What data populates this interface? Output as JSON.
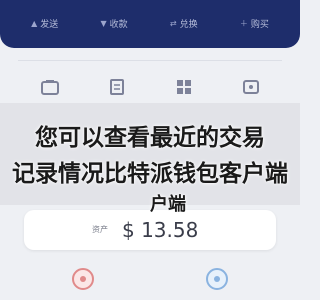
{
  "top_bar": {
    "items": [
      {
        "icon": "send-icon",
        "label": "发送"
      },
      {
        "icon": "receive-icon",
        "label": "收款"
      },
      {
        "icon": "swap-icon",
        "label": "兑换"
      },
      {
        "icon": "buy-icon",
        "label": "购买"
      }
    ]
  },
  "feature_icons": [
    "wallet-icon",
    "document-icon",
    "grid-icon",
    "more-icon"
  ],
  "overlay": {
    "line1": "您可以查看最近的交易",
    "line2": "记录情况比特派钱包客户端",
    "line3": "户端"
  },
  "balance": {
    "label": "资产",
    "amount": "$ 13.58"
  },
  "bottom_avatars": [
    "avatar-red",
    "avatar-blue"
  ]
}
